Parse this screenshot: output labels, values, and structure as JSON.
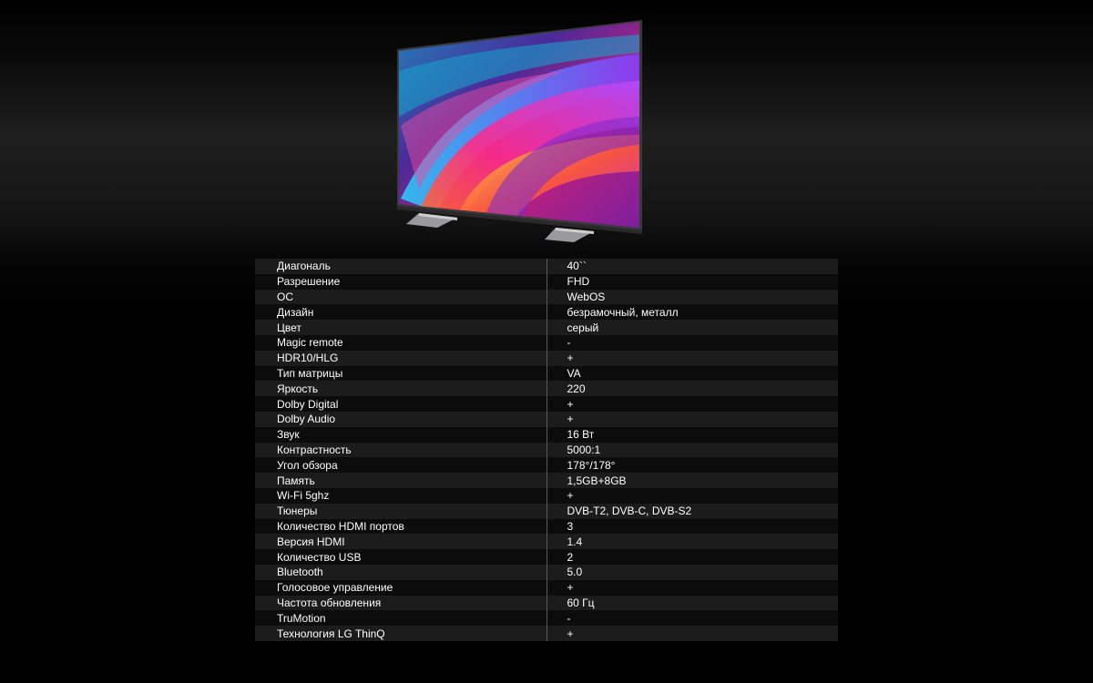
{
  "product_image": {
    "alt": "LG TV"
  },
  "specs": [
    {
      "label": "Диагональ",
      "value": "40``"
    },
    {
      "label": "Разрешение",
      "value": "FHD"
    },
    {
      "label": "ОС",
      "value": "WebOS"
    },
    {
      "label": "Дизайн",
      "value": "безрамочный, металл"
    },
    {
      "label": "Цвет",
      "value": "серый"
    },
    {
      "label": "Magic remote",
      "value": "-"
    },
    {
      "label": "HDR10/HLG",
      "value": "+"
    },
    {
      "label": "Тип матрицы",
      "value": "VA"
    },
    {
      "label": "Яркость",
      "value": "220"
    },
    {
      "label": "Dolby Digital",
      "value": "+"
    },
    {
      "label": "Dolby Audio",
      "value": "+"
    },
    {
      "label": "Звук",
      "value": "16 Вт"
    },
    {
      "label": "Контрастность",
      "value": "5000:1"
    },
    {
      "label": "Угол обзора",
      "value": "178°/178°"
    },
    {
      "label": "Память",
      "value": "1,5GB+8GB"
    },
    {
      "label": "Wi-Fi 5ghz",
      "value": "+"
    },
    {
      "label": "Тюнеры",
      "value": "DVB-T2, DVB-C, DVB-S2"
    },
    {
      "label": "Количество HDMI портов",
      "value": "3"
    },
    {
      "label": "Версия HDMI",
      "value": "1.4"
    },
    {
      "label": "Количество USB",
      "value": "2"
    },
    {
      "label": "Bluetooth",
      "value": "5.0"
    },
    {
      "label": "Голосовое управление",
      "value": "+"
    },
    {
      "label": "Частота обновления",
      "value": "60 Гц"
    },
    {
      "label": "TruMotion",
      "value": "-"
    },
    {
      "label": "Технология LG ThinQ",
      "value": "+"
    }
  ]
}
